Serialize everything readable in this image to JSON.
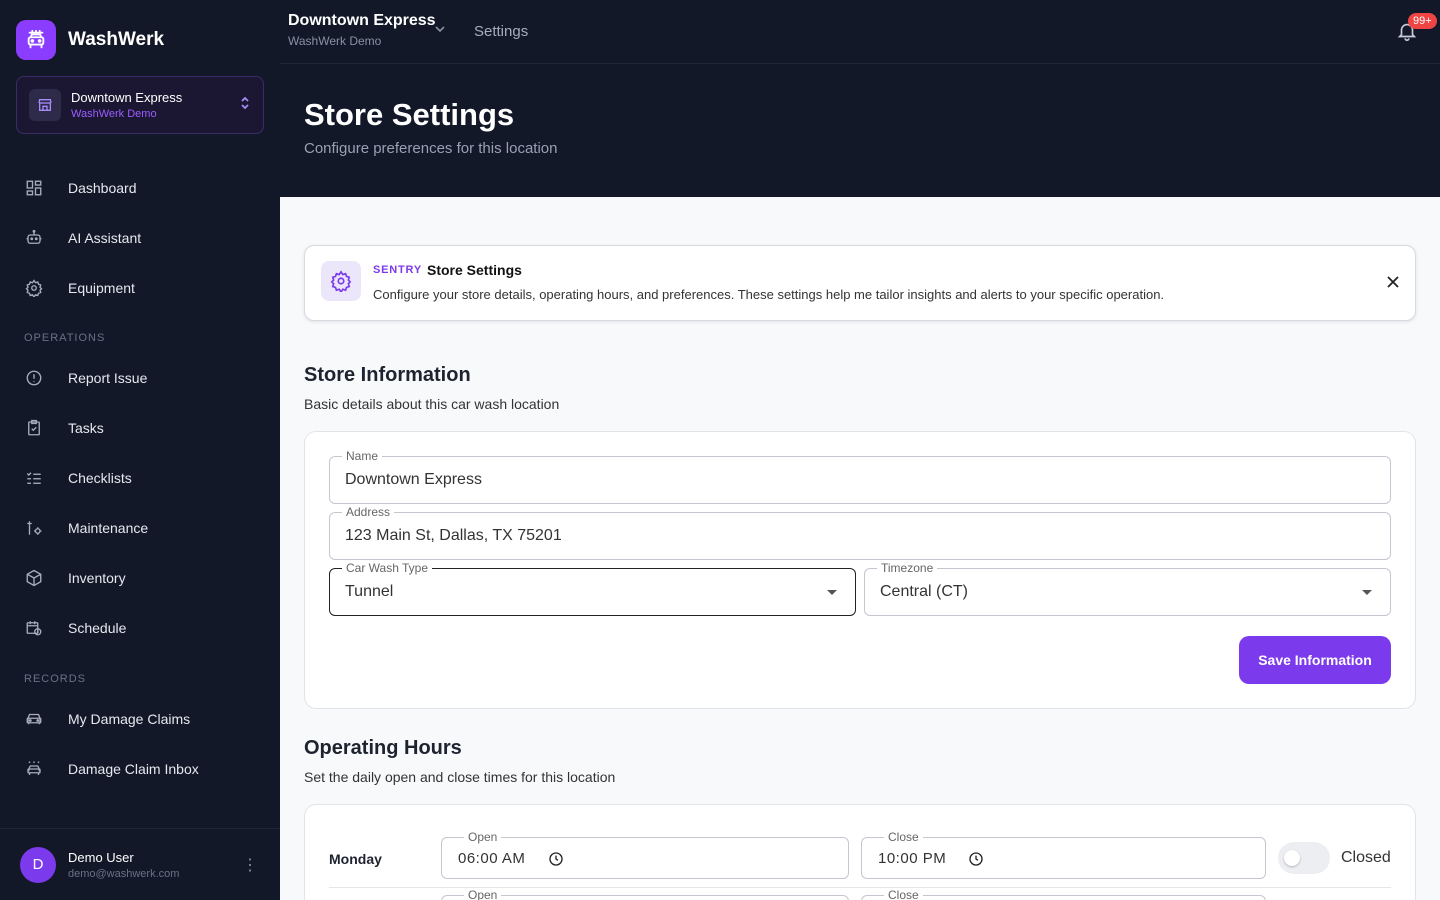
{
  "brand": {
    "name": "WashWerk"
  },
  "store_selector": {
    "name": "Downtown Express",
    "org": "WashWerk Demo"
  },
  "nav": {
    "main": [
      {
        "label": "Dashboard",
        "icon": "dashboard-icon"
      },
      {
        "label": "AI Assistant",
        "icon": "robot-icon"
      },
      {
        "label": "Equipment",
        "icon": "gear-icon"
      }
    ],
    "operations_header": "OPERATIONS",
    "operations": [
      {
        "label": "Report Issue",
        "icon": "alert-circle-icon"
      },
      {
        "label": "Tasks",
        "icon": "clipboard-check-icon"
      },
      {
        "label": "Checklists",
        "icon": "checklist-icon"
      },
      {
        "label": "Maintenance",
        "icon": "wrench-icon"
      },
      {
        "label": "Inventory",
        "icon": "box-icon"
      },
      {
        "label": "Schedule",
        "icon": "calendar-clock-icon"
      }
    ],
    "records_header": "RECORDS",
    "records": [
      {
        "label": "My Damage Claims",
        "icon": "car-icon"
      },
      {
        "label": "Damage Claim Inbox",
        "icon": "car-wash-icon"
      }
    ]
  },
  "user": {
    "initial": "D",
    "name": "Demo User",
    "email": "demo@washwerk.com"
  },
  "topbar": {
    "store_name": "Downtown Express",
    "org": "WashWerk Demo",
    "crumb": "Settings",
    "badge": "99+"
  },
  "page": {
    "title": "Store Settings",
    "subtitle": "Configure preferences for this location"
  },
  "alert": {
    "tag": "SENTRY",
    "title": "Store Settings",
    "text": "Configure your store details, operating hours, and preferences. These settings help me tailor insights and alerts to your specific operation."
  },
  "store_info": {
    "title": "Store Information",
    "subtitle": "Basic details about this car wash location",
    "name_label": "Name",
    "name_value": "Downtown Express",
    "address_label": "Address",
    "address_value": "123 Main St, Dallas, TX 75201",
    "type_label": "Car Wash Type",
    "type_value": "Tunnel",
    "tz_label": "Timezone",
    "tz_value": "Central (CT)",
    "save_label": "Save Information"
  },
  "hours": {
    "title": "Operating Hours",
    "subtitle": "Set the daily open and close times for this location",
    "open_label": "Open",
    "close_label": "Close",
    "closed_label": "Closed",
    "monday": {
      "day": "Monday",
      "open": "06:00 AM",
      "close": "10:00 PM",
      "closed": false
    }
  },
  "colors": {
    "accent": "#7c3aed",
    "sidebar": "#131828",
    "badge": "#ef4444"
  }
}
